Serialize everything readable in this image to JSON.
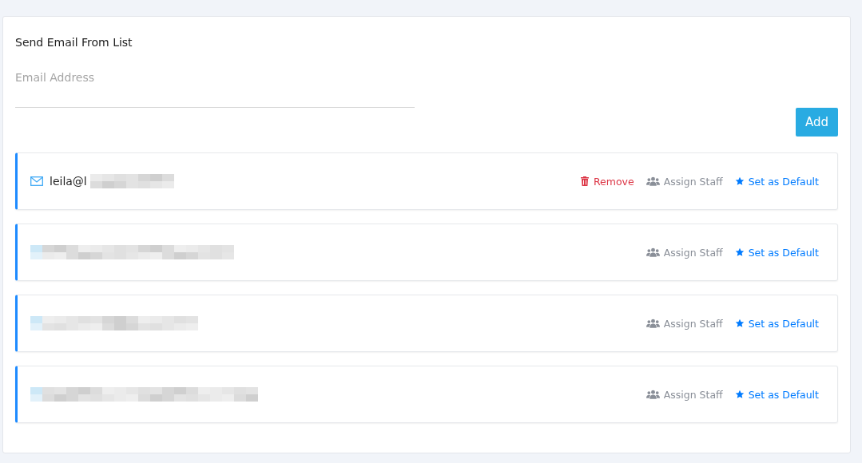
{
  "title": "Send Email From List",
  "email_field": {
    "placeholder": "Email Address"
  },
  "add_button": "Add",
  "emails": [
    {
      "address": "leila@l",
      "removable": true,
      "remove_label": "Remove",
      "assign_label": "Assign Staff",
      "default_label": "Set as Default"
    },
    {
      "removable": false,
      "assign_label": "Assign Staff",
      "default_label": "Set as Default"
    },
    {
      "removable": false,
      "assign_label": "Assign Staff",
      "default_label": "Set as Default"
    },
    {
      "removable": false,
      "assign_label": "Assign Staff",
      "default_label": "Set as Default"
    }
  ]
}
